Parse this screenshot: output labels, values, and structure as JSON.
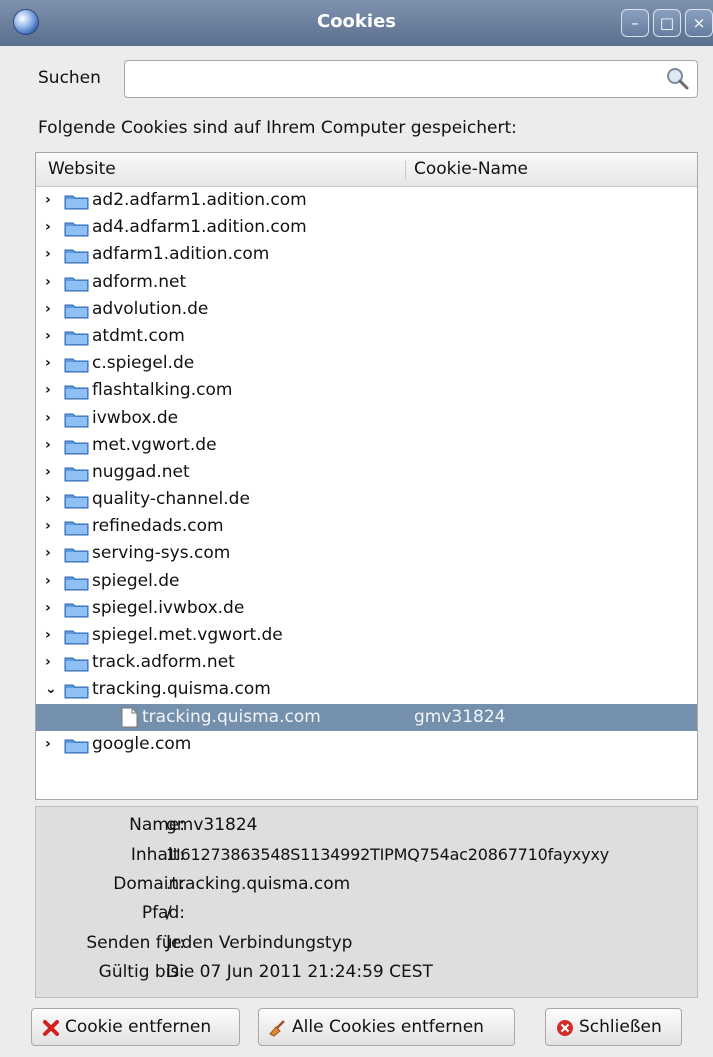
{
  "window": {
    "title": "Cookies"
  },
  "search": {
    "label": "Suchen",
    "value": "",
    "placeholder": ""
  },
  "caption": "Folgende Cookies sind auf Ihrem Computer gespeichert:",
  "table": {
    "columns": [
      "Website",
      "Cookie-Name"
    ],
    "sites": [
      "ad2.adfarm1.adition.com",
      "ad4.adfarm1.adition.com",
      "adfarm1.adition.com",
      "adform.net",
      "advolution.de",
      "atdmt.com",
      "c.spiegel.de",
      "flashtalking.com",
      "ivwbox.de",
      "met.vgwort.de",
      "nuggad.net",
      "quality-channel.de",
      "refinedads.com",
      "serving-sys.com",
      "spiegel.de",
      "spiegel.ivwbox.de",
      "spiegel.met.vgwort.de",
      "track.adform.net",
      "tracking.quisma.com"
    ],
    "selected_cookie": {
      "site": "tracking.quisma.com",
      "name": "gmv31824"
    },
    "last_site": "google.com"
  },
  "details": {
    "name_label": "Name:",
    "name": "gmv31824",
    "content_label": "Inhalt:",
    "content": "1I61273863548S1134992TIPMQ754ac20867710fayxyxy",
    "domain_label": "Domain:",
    "domain": ".tracking.quisma.com",
    "path_label": "Pfad:",
    "path": "/",
    "send_label": "Senden für:",
    "send": "Jeden Verbindungstyp",
    "expires_label": "Gültig bis:",
    "expires": "Die 07 Jun 2011 21:24:59 CEST"
  },
  "buttons": {
    "remove": "Cookie entfernen",
    "remove_all": "Alle Cookies entfernen",
    "close": "Schließen"
  },
  "colors": {
    "titlebar": "#5b6f8e",
    "selection": "#7590ac",
    "folder": "#5c9be0"
  },
  "icons": [
    "app-globe-icon",
    "minimize-icon",
    "maximize-icon",
    "close-icon",
    "search-icon",
    "folder-icon",
    "document-icon",
    "delete-icon",
    "broom-icon",
    "close-circle-icon"
  ]
}
